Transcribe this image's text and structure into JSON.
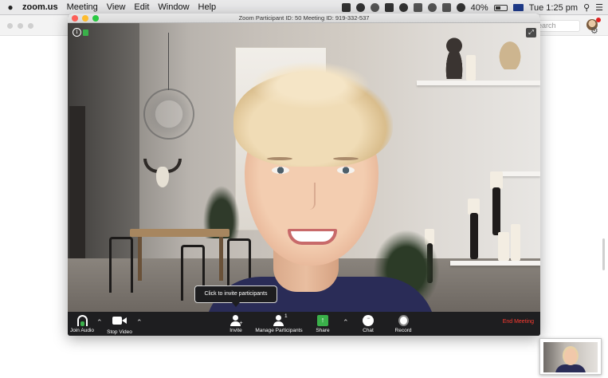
{
  "menubar": {
    "app_name": "zoom.us",
    "items": [
      "Meeting",
      "View",
      "Edit",
      "Window",
      "Help"
    ],
    "battery": "40%",
    "clock": "Tue 1:25 pm"
  },
  "background_window": {
    "search_placeholder": "Search",
    "search_visible_text": "earch"
  },
  "meeting": {
    "title": "Zoom Participant ID: 50   Meeting ID: 919-332-537",
    "tooltip": "Click to invite participants",
    "toolbar": {
      "join_audio": "Join Audio",
      "stop_video": "Stop Video",
      "invite": "Invite",
      "manage_participants": "Manage Participants",
      "participant_count": "1",
      "share": "Share",
      "chat": "Chat",
      "record": "Record",
      "end_meeting": "End Meeting"
    }
  },
  "colors": {
    "end_meeting": "#ff3b30",
    "share_green": "#3ab04a",
    "toolbar_bg": "#1e1e20"
  },
  "icons": [
    "apple-icon",
    "info-icon",
    "lock-icon",
    "fullscreen-icon",
    "headset-icon",
    "camera-icon",
    "invite-icon",
    "participants-icon",
    "share-icon",
    "chat-icon",
    "record-icon",
    "gear-icon"
  ]
}
